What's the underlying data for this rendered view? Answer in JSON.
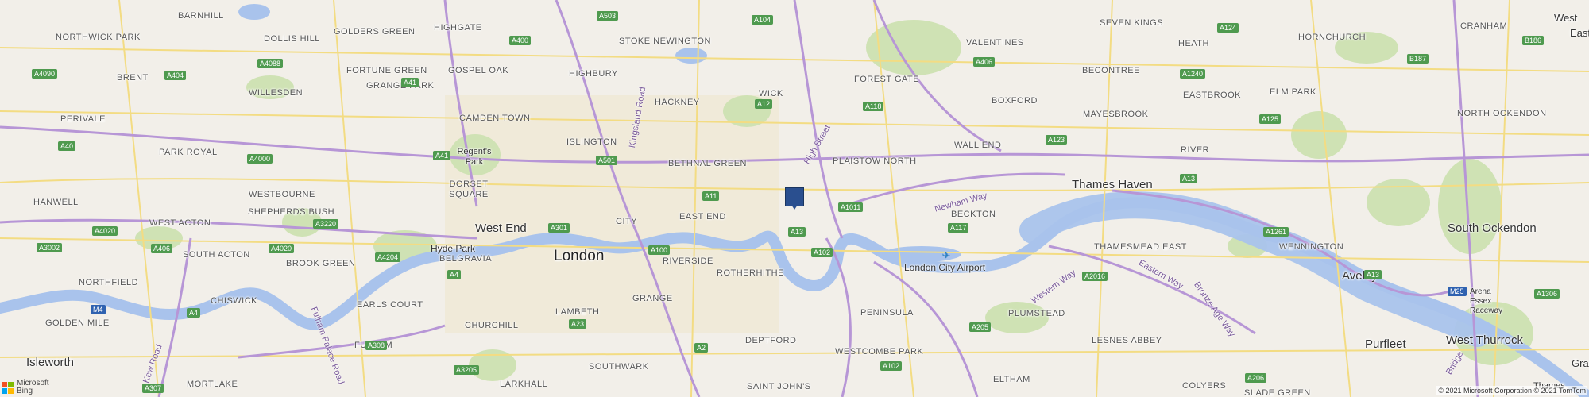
{
  "map": {
    "areas": [
      {
        "text": "BARNHILL",
        "cls": "lbl"
      },
      {
        "text": "GOLDERS GREEN",
        "cls": "lbl"
      },
      {
        "text": "HIGHGATE",
        "cls": "lbl"
      },
      {
        "text": "NORTHWICK PARK",
        "cls": "lbl"
      },
      {
        "text": "DOLLIS HILL",
        "cls": "lbl"
      },
      {
        "text": "STOKE NEWINGTON",
        "cls": "lbl"
      },
      {
        "text": "VALENTINES",
        "cls": "lbl"
      },
      {
        "text": "SEVEN KINGS",
        "cls": "lbl"
      },
      {
        "text": "HORNCHURCH",
        "cls": "lbl"
      },
      {
        "text": "CRANHAM",
        "cls": "lbl"
      },
      {
        "text": "BRENT",
        "cls": "lbl"
      },
      {
        "text": "FORTUNE GREEN",
        "cls": "lbl"
      },
      {
        "text": "GOSPEL OAK",
        "cls": "lbl"
      },
      {
        "text": "HIGHBURY",
        "cls": "lbl"
      },
      {
        "text": "FOREST GATE",
        "cls": "lbl"
      },
      {
        "text": "BECONTREE",
        "cls": "lbl"
      },
      {
        "text": "HEATH",
        "cls": "lbl"
      },
      {
        "text": "ELM PARK",
        "cls": "lbl"
      },
      {
        "text": "WILLESDEN",
        "cls": "lbl"
      },
      {
        "text": "GRANGE PARK",
        "cls": "lbl"
      },
      {
        "text": "HACKNEY",
        "cls": "lbl"
      },
      {
        "text": "WICK",
        "cls": "lbl"
      },
      {
        "text": "BOXFORD",
        "cls": "lbl"
      },
      {
        "text": "MAYESBROOK",
        "cls": "lbl"
      },
      {
        "text": "EASTBROOK",
        "cls": "lbl"
      },
      {
        "text": "PERIVALE",
        "cls": "lbl"
      },
      {
        "text": "CAMDEN TOWN",
        "cls": "lbl"
      },
      {
        "text": "NORTH OCKENDON",
        "cls": "lbl"
      },
      {
        "text": "PARK ROYAL",
        "cls": "lbl"
      },
      {
        "text": "ISLINGTON",
        "cls": "lbl"
      },
      {
        "text": "Regent's Park",
        "cls": "lbl city"
      },
      {
        "text": "BETHNAL GREEN",
        "cls": "lbl"
      },
      {
        "text": "PLAISTOW NORTH",
        "cls": "lbl"
      },
      {
        "text": "WALL END",
        "cls": "lbl"
      },
      {
        "text": "RIVER",
        "cls": "lbl"
      },
      {
        "text": "DORSET SQUARE",
        "cls": "lbl"
      },
      {
        "text": "Thames Haven",
        "cls": "lbl city"
      },
      {
        "text": "WESTBOURNE",
        "cls": "lbl"
      },
      {
        "text": "HANWELL",
        "cls": "lbl"
      },
      {
        "text": "SHEPHERDS BUSH",
        "cls": "lbl"
      },
      {
        "text": "BECKTON",
        "cls": "lbl"
      },
      {
        "text": "EAST END",
        "cls": "lbl"
      },
      {
        "text": "CITY",
        "cls": "lbl"
      },
      {
        "text": "West End",
        "cls": "lbl city"
      },
      {
        "text": "WEST ACTON",
        "cls": "lbl"
      },
      {
        "text": "South Ockendon",
        "cls": "lbl city"
      },
      {
        "text": "THAMESMEAD EAST",
        "cls": "lbl"
      },
      {
        "text": "Hyde Park",
        "cls": "lbl city"
      },
      {
        "text": "SOUTH ACTON",
        "cls": "lbl"
      },
      {
        "text": "WENNINGTON",
        "cls": "lbl"
      },
      {
        "text": "BROOK GREEN",
        "cls": "lbl"
      },
      {
        "text": "BELGRAVIA",
        "cls": "lbl"
      },
      {
        "text": "London",
        "cls": "lbl big"
      },
      {
        "text": "RIVERSIDE",
        "cls": "lbl"
      },
      {
        "text": "London City Airport",
        "cls": "lbl city"
      },
      {
        "text": "ROTHERHITHE",
        "cls": "lbl"
      },
      {
        "text": "Aveley",
        "cls": "lbl city"
      },
      {
        "text": "NORTHFIELD",
        "cls": "lbl"
      },
      {
        "text": "EARLS COURT",
        "cls": "lbl"
      },
      {
        "text": "CHISWICK",
        "cls": "lbl"
      },
      {
        "text": "Arena Essex Raceway",
        "cls": "lbl city"
      },
      {
        "text": "GRANGE",
        "cls": "lbl"
      },
      {
        "text": "LAMBETH",
        "cls": "lbl"
      },
      {
        "text": "PENINSULA",
        "cls": "lbl"
      },
      {
        "text": "PLUMSTEAD",
        "cls": "lbl"
      },
      {
        "text": "GOLDEN MILE",
        "cls": "lbl"
      },
      {
        "text": "CHURCHILL",
        "cls": "lbl"
      },
      {
        "text": "Purfleet",
        "cls": "lbl city"
      },
      {
        "text": "LESNES ABBEY",
        "cls": "lbl"
      },
      {
        "text": "West Thurrock",
        "cls": "lbl city"
      },
      {
        "text": "FULHAM",
        "cls": "lbl"
      },
      {
        "text": "DEPTFORD",
        "cls": "lbl"
      },
      {
        "text": "WESTCOMBE PARK",
        "cls": "lbl"
      },
      {
        "text": "Isleworth",
        "cls": "lbl city"
      },
      {
        "text": "SOUTHWARK",
        "cls": "lbl"
      },
      {
        "text": "ELTHAM",
        "cls": "lbl"
      },
      {
        "text": "MORTLAKE",
        "cls": "lbl"
      },
      {
        "text": "LARKHALL",
        "cls": "lbl"
      },
      {
        "text": "SAINT JOHN'S",
        "cls": "lbl"
      },
      {
        "text": "COLYERS",
        "cls": "lbl"
      },
      {
        "text": "SLADE GREEN",
        "cls": "lbl"
      },
      {
        "text": "Thames",
        "cls": "lbl city"
      },
      {
        "text": "East",
        "cls": "lbl city"
      },
      {
        "text": "West",
        "cls": "lbl city"
      },
      {
        "text": "Gra",
        "cls": "lbl city"
      }
    ],
    "road_names": [
      {
        "text": "Kingsland Road"
      },
      {
        "text": "High Street"
      },
      {
        "text": "Newham Way"
      },
      {
        "text": "Western Way"
      },
      {
        "text": "Eastern Way"
      },
      {
        "text": "Bronze Age Way"
      },
      {
        "text": "Fulham Palace Road"
      },
      {
        "text": "Kew Road"
      },
      {
        "text": "Bridge"
      }
    ],
    "shields": [
      {
        "text": "A503",
        "type": "a"
      },
      {
        "text": "A104",
        "type": "a"
      },
      {
        "text": "A406",
        "type": "a"
      },
      {
        "text": "A124",
        "type": "a"
      },
      {
        "text": "B186",
        "type": "a"
      },
      {
        "text": "A400",
        "type": "a"
      },
      {
        "text": "A4090",
        "type": "a"
      },
      {
        "text": "A404",
        "type": "a"
      },
      {
        "text": "A4088",
        "type": "a"
      },
      {
        "text": "A41",
        "type": "a"
      },
      {
        "text": "A1240",
        "type": "a"
      },
      {
        "text": "B187",
        "type": "a"
      },
      {
        "text": "A12",
        "type": "a"
      },
      {
        "text": "A118",
        "type": "a"
      },
      {
        "text": "A125",
        "type": "a"
      },
      {
        "text": "A40",
        "type": "a"
      },
      {
        "text": "A41",
        "type": "a"
      },
      {
        "text": "A4000",
        "type": "a"
      },
      {
        "text": "A501",
        "type": "a"
      },
      {
        "text": "A123",
        "type": "a"
      },
      {
        "text": "A13",
        "type": "a"
      },
      {
        "text": "A11",
        "type": "a"
      },
      {
        "text": "A1011",
        "type": "a"
      },
      {
        "text": "A3220",
        "type": "a"
      },
      {
        "text": "A117",
        "type": "a"
      },
      {
        "text": "A4020",
        "type": "a"
      },
      {
        "text": "A301",
        "type": "a"
      },
      {
        "text": "A13",
        "type": "a"
      },
      {
        "text": "A1261",
        "type": "a"
      },
      {
        "text": "A3002",
        "type": "a"
      },
      {
        "text": "A406",
        "type": "a"
      },
      {
        "text": "A4020",
        "type": "a"
      },
      {
        "text": "A4204",
        "type": "a"
      },
      {
        "text": "A100",
        "type": "a"
      },
      {
        "text": "A102",
        "type": "a"
      },
      {
        "text": "A2016",
        "type": "a"
      },
      {
        "text": "A4",
        "type": "a"
      },
      {
        "text": "A13",
        "type": "a"
      },
      {
        "text": "M4",
        "type": "m"
      },
      {
        "text": "M25",
        "type": "m"
      },
      {
        "text": "A1306",
        "type": "a"
      },
      {
        "text": "A4",
        "type": "a"
      },
      {
        "text": "A23",
        "type": "a"
      },
      {
        "text": "A205",
        "type": "a"
      },
      {
        "text": "A308",
        "type": "a"
      },
      {
        "text": "A2",
        "type": "a"
      },
      {
        "text": "A3205",
        "type": "a"
      },
      {
        "text": "A102",
        "type": "a"
      },
      {
        "text": "A206",
        "type": "a"
      },
      {
        "text": "A307",
        "type": "a"
      }
    ],
    "pin_icon": "location-pin-icon",
    "airport_icon": "airport-icon",
    "bing": {
      "line1": "Microsoft",
      "line2": "Bing",
      "colors": [
        "#f25022",
        "#7fba00",
        "#00a4ef",
        "#ffb900"
      ]
    },
    "copyright": "© 2021 Microsoft Corporation © 2021 TomTom",
    "colors": {
      "water": "#a9c3ec",
      "park": "#cfe2b4",
      "urban": "#efe9d4",
      "roads_major": "#b796d6",
      "roads_minor": "#f3dc83"
    }
  }
}
